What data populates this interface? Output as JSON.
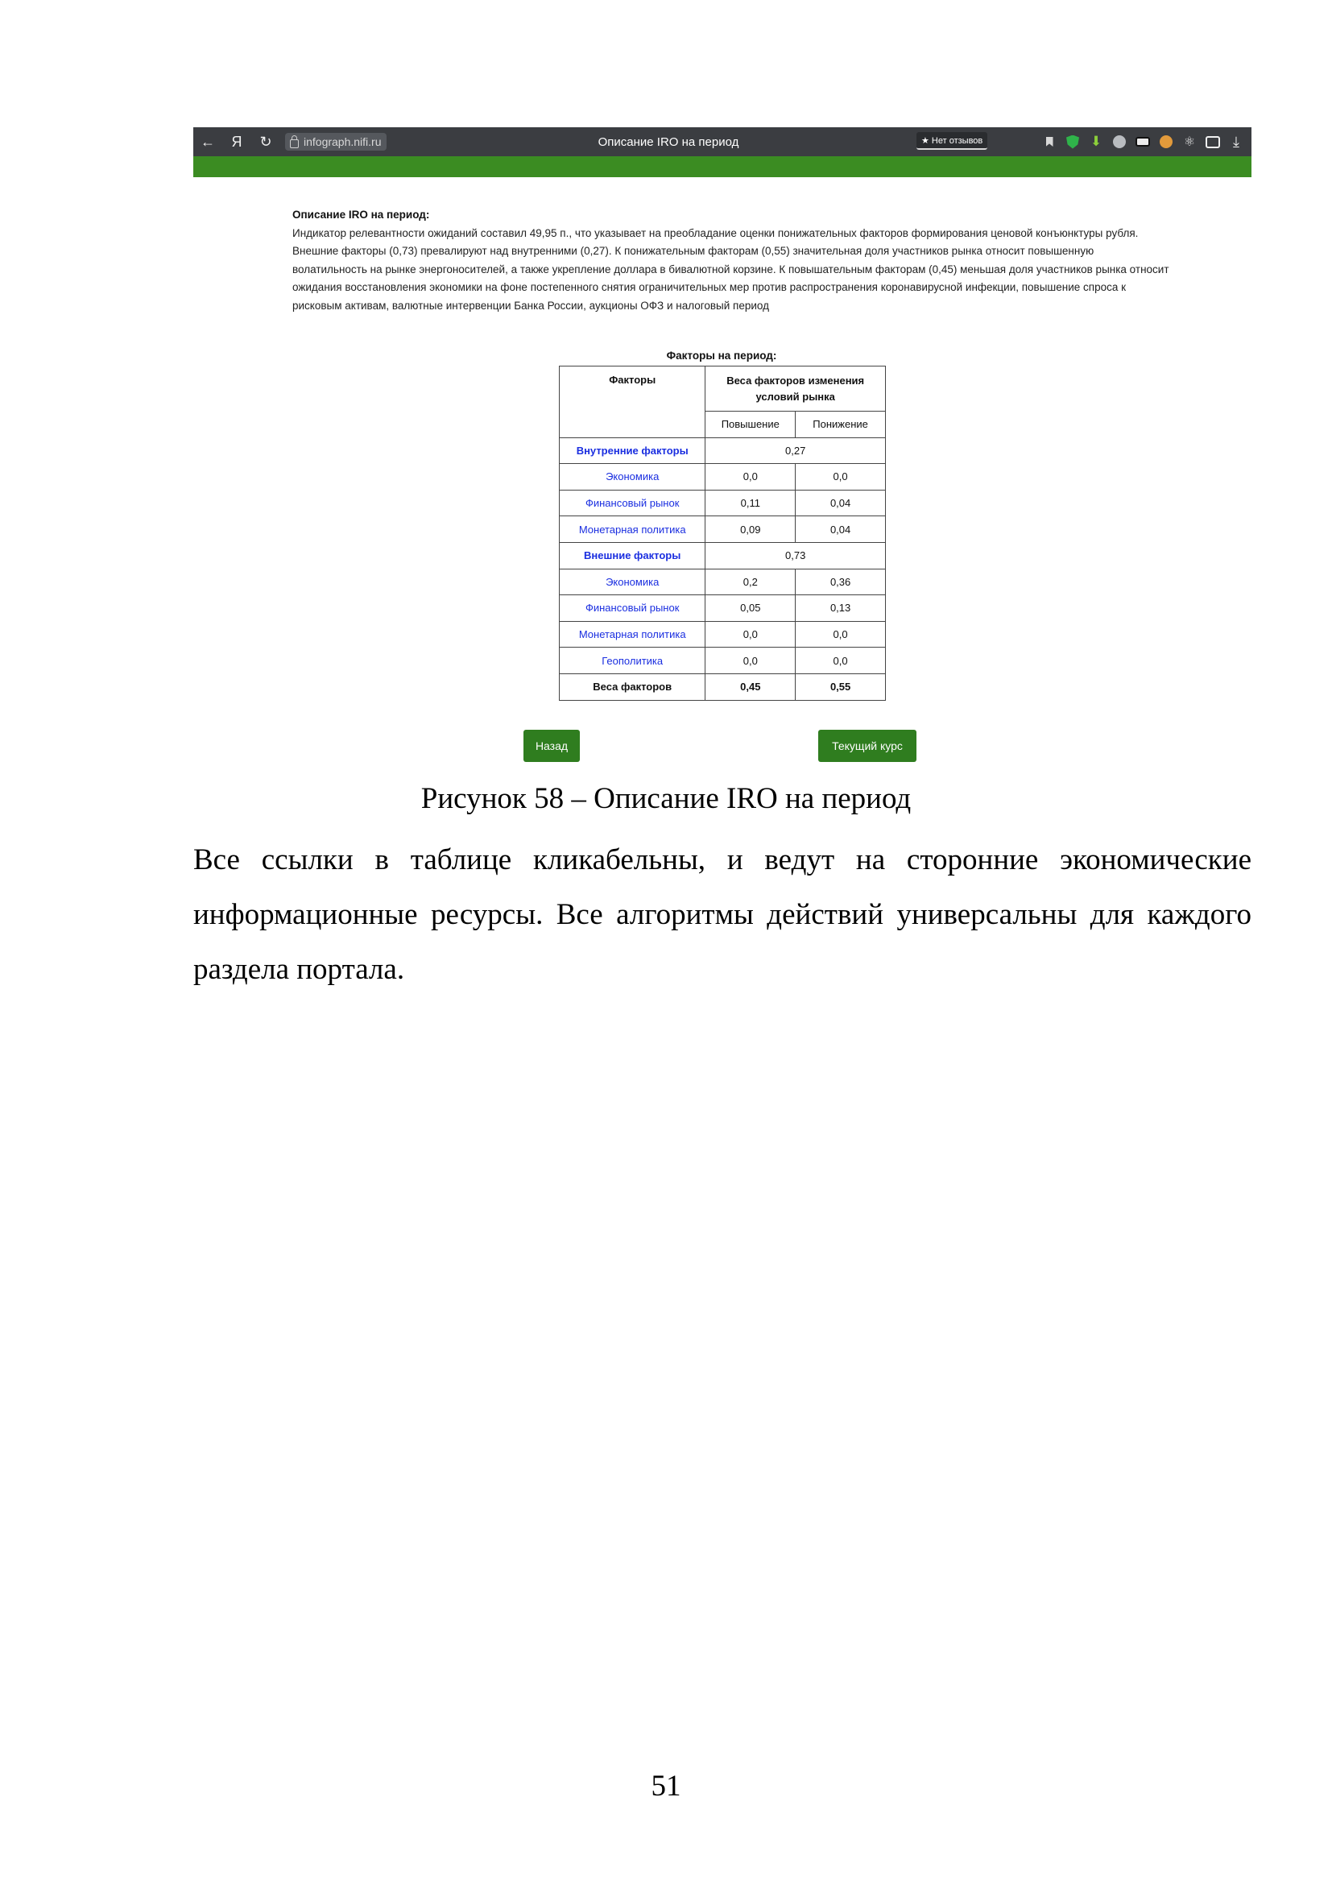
{
  "browser": {
    "back_icon": "←",
    "yandex_icon": "Я",
    "reload_icon": "↻",
    "url": "infograph.nifi.ru",
    "tab_title": "Описание IRO на период",
    "reviews_label": "★ Нет отзывов",
    "download_icon": "⤓",
    "atom_icon": "⚛"
  },
  "iro": {
    "heading": "Описание IRO на период:",
    "description": "Индикатор релевантности ожиданий составил 49,95 п., что указывает на преобладание оценки понижательных факторов формирования ценовой конъюнктуры рубля. Внешние факторы (0,73) превалируют над внутренними (0,27). К понижательным факторам (0,55) значительная доля участников рынка относит повышенную волатильность на рынке энергоносителей, а также укрепление доллара в бивалютной корзине. К повышательным факторам (0,45) меньшая доля участников рынка относит ожидания восстановления экономики на фоне постепенного снятия ограничительных мер против распространения коронавирусной инфекции, повышение спроса к рисковым активам, валютные интервенции Банка России, аукционы ОФЗ и налоговый период"
  },
  "factors_table": {
    "caption": "Факторы на период:",
    "col_factors": "Факторы",
    "col_weights": "Веса факторов изменения условий рынка",
    "col_up": "Повышение",
    "col_down": "Понижение",
    "internal": {
      "label": "Внутренние факторы",
      "value": "0,27",
      "rows": [
        {
          "name": "Экономика",
          "up": "0,0",
          "down": "0,0"
        },
        {
          "name": "Финансовый рынок",
          "up": "0,11",
          "down": "0,04"
        },
        {
          "name": "Монетарная политика",
          "up": "0,09",
          "down": "0,04"
        }
      ]
    },
    "external": {
      "label": "Внешние факторы",
      "value": "0,73",
      "rows": [
        {
          "name": "Экономика",
          "up": "0,2",
          "down": "0,36"
        },
        {
          "name": "Финансовый рынок",
          "up": "0,05",
          "down": "0,13"
        },
        {
          "name": "Монетарная политика",
          "up": "0,0",
          "down": "0,0"
        },
        {
          "name": "Геополитика",
          "up": "0,0",
          "down": "0,0"
        }
      ]
    },
    "total": {
      "label": "Веса факторов",
      "up": "0,45",
      "down": "0,55"
    }
  },
  "buttons": {
    "back": "Назад",
    "current_rate": "Текущий курс"
  },
  "document": {
    "figure_caption": "Рисунок 58 – Описание IRO на период",
    "paragraph": "Все ссылки в таблице кликабельны, и ведут на сторонние экономические информационные ресурсы. Все алгоритмы действий универсальны для каждого раздела портала.",
    "page_number": "51"
  }
}
